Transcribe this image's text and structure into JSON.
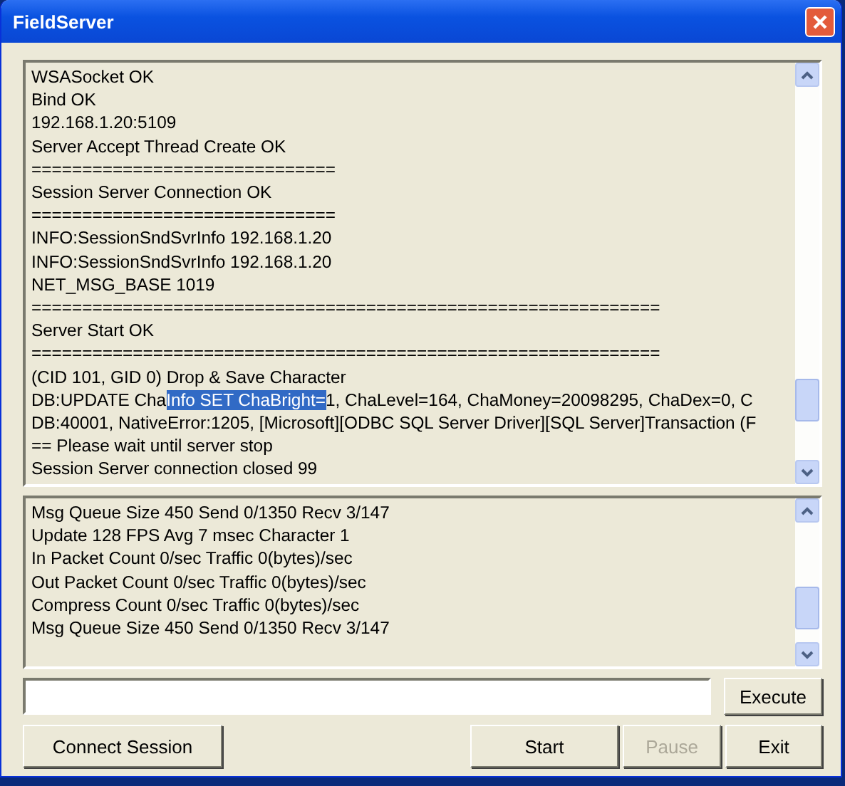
{
  "window": {
    "title": "FieldServer"
  },
  "log_panel": {
    "lines": [
      "WSASocket OK",
      "Bind OK",
      "192.168.1.20:5109",
      "Server Accept Thread Create OK",
      "==============================",
      "Session Server Connection OK",
      "==============================",
      "INFO:SessionSndSvrInfo 192.168.1.20",
      "INFO:SessionSndSvrInfo 192.168.1.20",
      "NET_MSG_BASE 1019",
      "==============================================================",
      "Server Start OK",
      "==============================================================",
      "(CID 101, GID 0) Drop & Save Character",
      {
        "segments": [
          {
            "text": "DB:UPDATE Cha",
            "selected": false
          },
          {
            "text": "Info SET ChaBright=",
            "selected": true
          },
          {
            "text": "1, ChaLevel=164, ChaMoney=20098295, ChaDex=0, C",
            "selected": false
          }
        ]
      },
      "DB:40001, NativeError:1205, [Microsoft][ODBC SQL Server Driver][SQL Server]Transaction (F",
      "== Please wait until server stop",
      "Session Server connection closed 99"
    ]
  },
  "status_panel": {
    "lines": [
      "Msg Queue Size 450 Send 0/1350 Recv 3/147",
      "Update 128 FPS Avg 7 msec Character 1",
      "In Packet Count 0/sec Traffic 0(bytes)/sec",
      "Out Packet Count 0/sec Traffic 0(bytes)/sec",
      "Compress Count 0/sec Traffic 0(bytes)/sec",
      "Msg Queue Size 450 Send 0/1350 Recv 3/147"
    ]
  },
  "command": {
    "execute_button": {
      "label": "Execute",
      "disabled": false
    }
  },
  "buttons": [
    {
      "label": "Connect Session",
      "disabled": false
    },
    {
      "label": "Start",
      "disabled": false
    },
    {
      "label": "Pause",
      "disabled": true
    },
    {
      "label": "Exit",
      "disabled": false
    }
  ]
}
